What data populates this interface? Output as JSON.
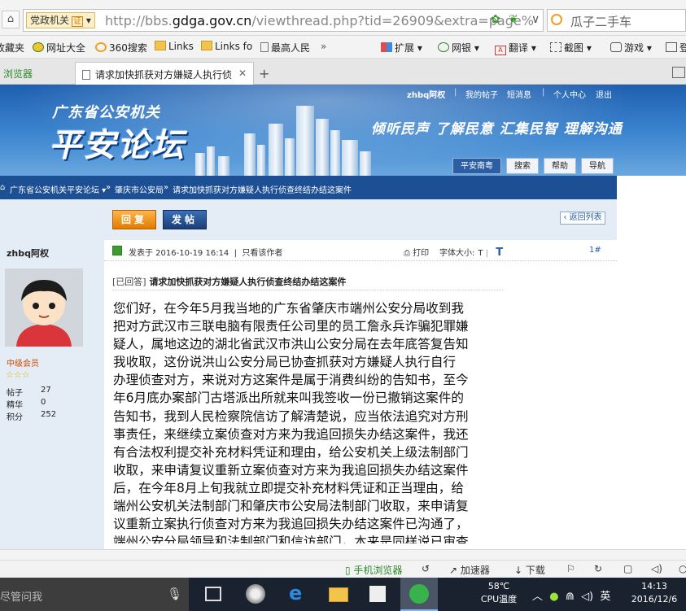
{
  "address_bar": {
    "mode_label": "党政机关",
    "cert_icon": "证",
    "url_prefix": "http://bbs.",
    "url_domain": "gdga.gov.cn",
    "url_path": "/viewthread.php?tid=26909&extra=page%",
    "search_text": "瓜子二手车"
  },
  "bookmarks": [
    {
      "label": "收藏夹",
      "icon": "star-icon"
    },
    {
      "label": "网址大全",
      "icon": "globe-icon"
    },
    {
      "label": "360搜索",
      "icon": "search-engine-icon"
    },
    {
      "label": "Links",
      "icon": "folder-icon"
    },
    {
      "label": "Links fo",
      "icon": "folder-icon"
    },
    {
      "label": "最高人民",
      "icon": "page-icon"
    },
    {
      "label": "»",
      "icon": ""
    },
    {
      "label": "扩展",
      "icon": "extensions-icon"
    },
    {
      "label": "网银",
      "icon": "bank-icon"
    },
    {
      "label": "翻译",
      "icon": "translate-icon"
    },
    {
      "label": "截图",
      "icon": "screenshot-icon"
    },
    {
      "label": "游戏",
      "icon": "game-icon"
    },
    {
      "label": "登",
      "icon": "login-icon"
    }
  ],
  "tabs": [
    {
      "label": "浏览器",
      "active": false
    },
    {
      "label": "请求加快抓获对方嫌疑人执行侦",
      "active": true
    }
  ],
  "banner": {
    "subtitle": "广东省公安机关",
    "title": "平安论坛",
    "slogan": "倾听民声  了解民意  汇集民智  理解沟通",
    "user_links": [
      "zhbq阿权",
      "|",
      "我的帖子",
      "短消息",
      "|",
      "个人中心",
      "退出"
    ],
    "nav_tabs": [
      "平安南粤",
      "搜索",
      "帮助",
      "导航"
    ]
  },
  "breadcrumb": [
    "广东省公安机关平安论坛 ▾",
    "»",
    "肇庆市公安局",
    "»",
    "请求加快抓获对方嫌疑人执行侦查终结办结这案件"
  ],
  "toolbar": {
    "reply_label": "回复",
    "post_label": "发帖",
    "back_label": "返回列表"
  },
  "author": {
    "name": "zhbq阿权",
    "level": "中级会员",
    "stars": "☆☆☆",
    "stats": [
      {
        "label": "帖子",
        "value": "27"
      },
      {
        "label": "精华",
        "value": "0"
      },
      {
        "label": "积分",
        "value": "252"
      }
    ]
  },
  "post": {
    "posted_at": "发表于 2016-10-19 16:14",
    "only_author": "只看该作者",
    "print_label": "打印",
    "font_size_label": "字体大小:",
    "font_small": "T",
    "font_large": "T",
    "floor": "1#",
    "tag": "[已回答]",
    "title": "请求加快抓获对方嫌疑人执行侦查终结办结这案件",
    "lines": [
      "您们好，在今年5月我当地的广东省肇庆市端州公安分局收到我",
      "把对方武汉市三联电脑有限责任公司里的员工詹永兵诈骗犯罪嫌",
      "疑人，属地这边的湖北省武汉市洪山公安分局在去年底答复告知",
      "我收取，这份说洪山公安分局已协查抓获对方嫌疑人执行自行",
      "办理侦查对方，来说对方这案件是属于消费纠纷的告知书，至今",
      "年6月底办案部门古塔派出所就来叫我签收一份已撤销这案件的",
      "告知书，我到人民检察院信访了解清楚说，应当依法追究对方刑",
      "事责任，来继续立案侦查对方来为我追回损失办结这案件，我还",
      "有合法权利提交补充材料凭证和理由，给公安机关上级法制部门",
      "收取，来申请复议重新立案侦查对方来为我追回损失办结这案件",
      "后，在今年8月上旬我就立即提交补充材料凭证和正当理由，给",
      "端州公安机关法制部门和肇庆市公安局法制部门收取，来申请复",
      "议重新立案执行侦查对方来为我追回损失办结这案件已沟通了，",
      "端州公安分局领导和法制部门和信访部门，本来是同样说已审查"
    ]
  },
  "status_bar": {
    "mobile_browser": "手机浏览器",
    "accelerator": "加速器",
    "download": "下载"
  },
  "taskbar": {
    "search_placeholder": "尽管问我",
    "cpu_temp": "58℃",
    "cpu_label": "CPU温度",
    "ime": "英",
    "time": "14:13",
    "date": "2016/12/6"
  },
  "colors": {
    "banner_blue": "#2b6dbd",
    "crumb_navy": "#1d4f94",
    "panel_bg": "#e4ecf5",
    "reply_orange": "#f09a1e",
    "taskbar_dark": "#1a2230"
  }
}
